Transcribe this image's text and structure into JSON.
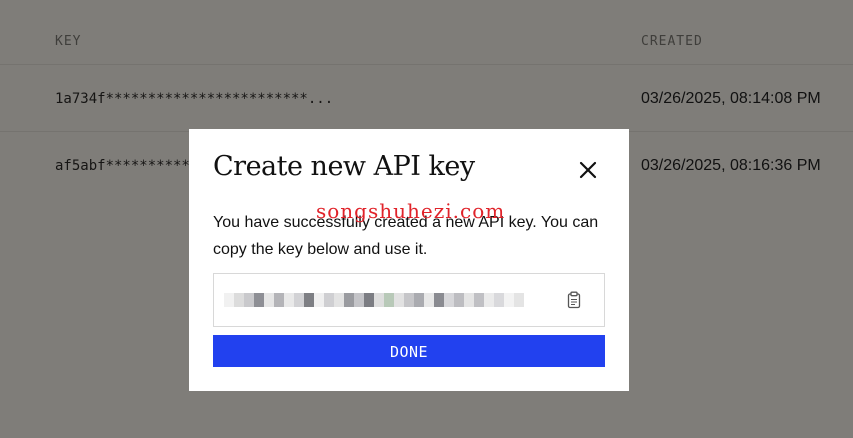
{
  "table": {
    "headers": {
      "key": "KEY",
      "created": "CREATED"
    },
    "rows": [
      {
        "key": "1a734f************************...",
        "created": "03/26/2025, 08:14:08 PM"
      },
      {
        "key": "af5abf**********",
        "created": "03/26/2025, 08:16:36 PM"
      }
    ]
  },
  "modal": {
    "title": "Create new API key",
    "message": "You have successfully created a new API key. You can copy the key below and use it.",
    "watermark": "songshuhezi.com",
    "done_label": "DONE",
    "close_icon": "close-icon",
    "copy_icon": "clipboard-icon"
  },
  "colors": {
    "overlay_bg": "#7f7d79",
    "accent": "#2241ef",
    "watermark": "#e0232a"
  }
}
